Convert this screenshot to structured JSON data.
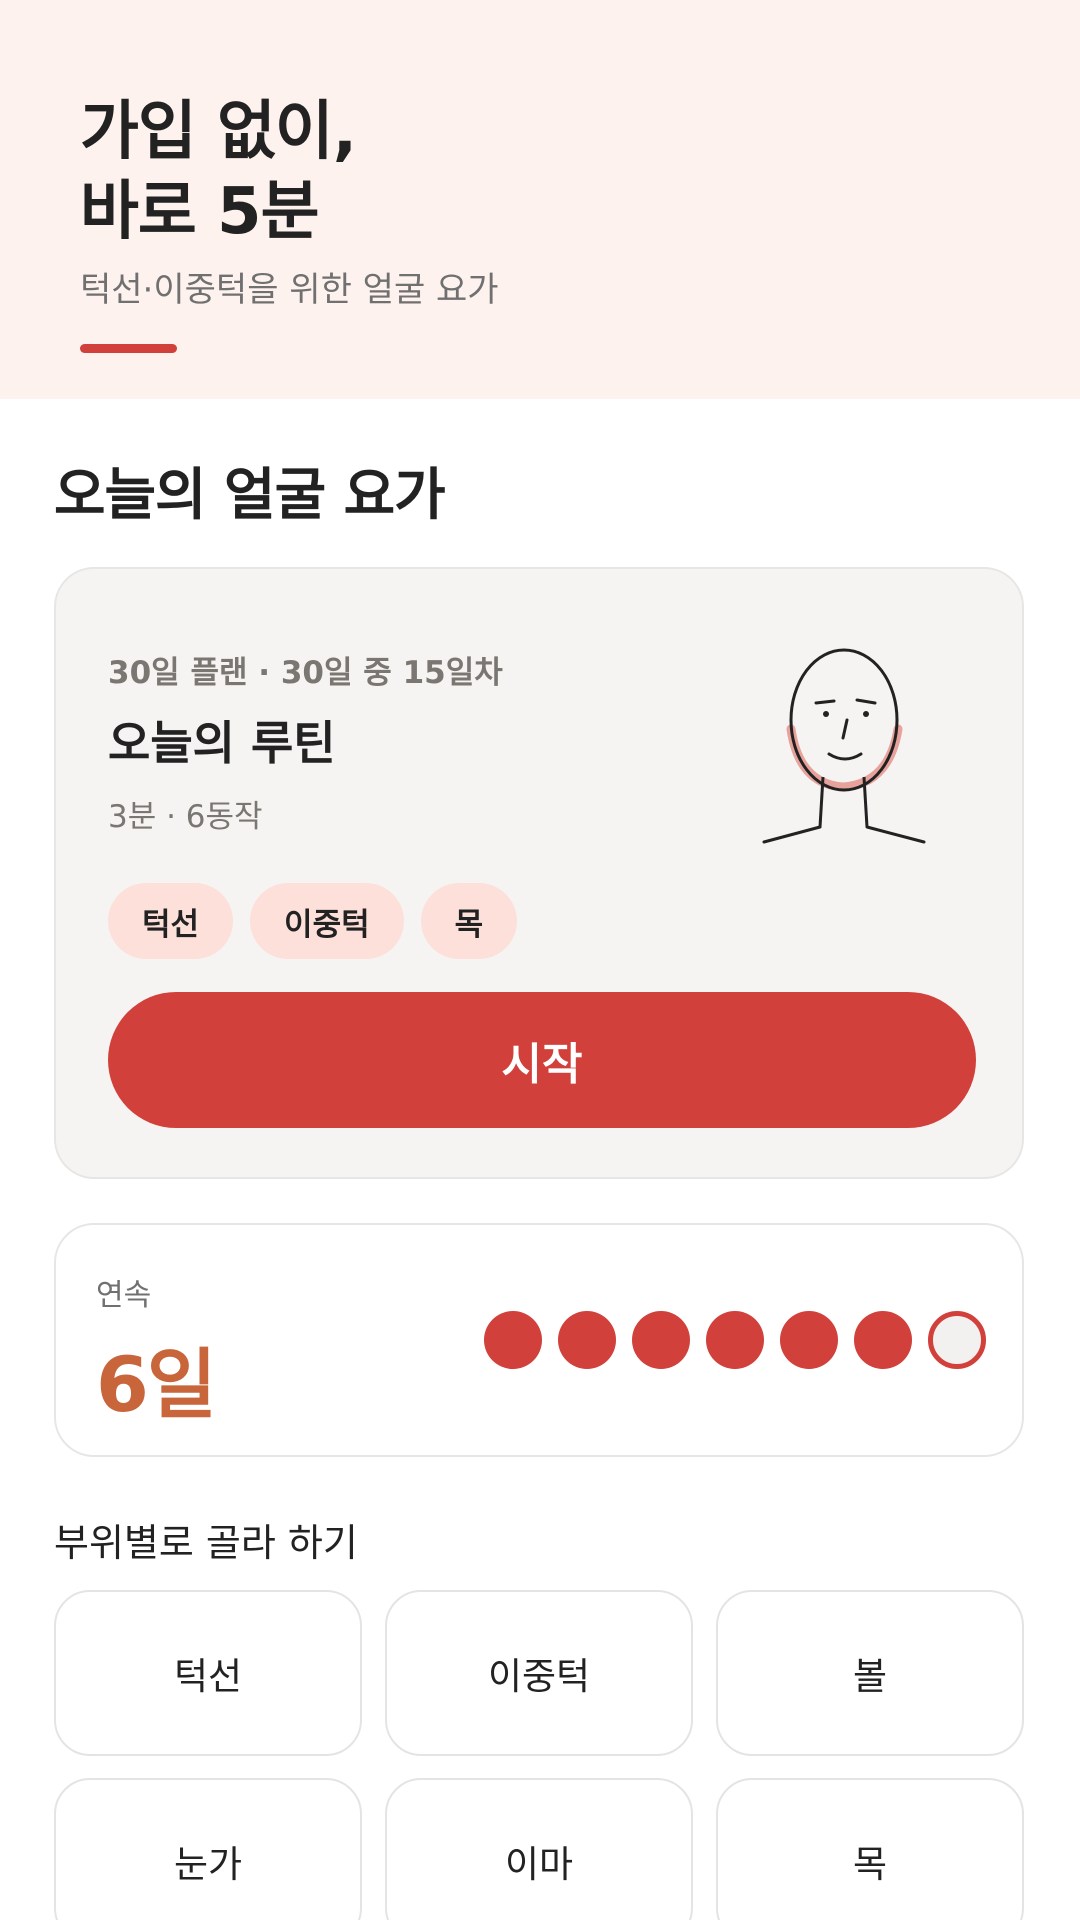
{
  "hero": {
    "title": "가입 없이,\n바로 5분",
    "subtitle": "턱선·이중턱을 위한 얼굴 요가"
  },
  "section_title": "오늘의 얼굴 요가",
  "routine": {
    "plan_meta": "30일 플랜 · 30일 중 15일차",
    "title": "오늘의 루틴",
    "meta": "3분 · 6동작",
    "tags": [
      "턱선",
      "이중턱",
      "목"
    ],
    "start_label": "시작",
    "illustration_icon": "face-jawline-icon"
  },
  "streak": {
    "label": "연속",
    "value": "6일",
    "completed_days": 6,
    "total_days": 7
  },
  "parts": {
    "title": "부위별로 골라 하기",
    "items": [
      "턱선",
      "이중턱",
      "볼",
      "눈가",
      "이마",
      "목"
    ]
  },
  "colors": {
    "accent": "#d1403a",
    "hero_bg": "#fdf2ee",
    "tag_bg": "#fde0da",
    "streak_text": "#c8653a"
  }
}
